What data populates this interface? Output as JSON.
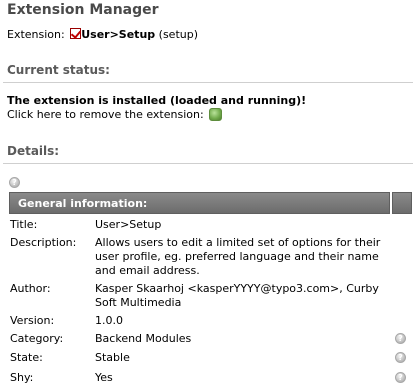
{
  "header": {
    "title": "Extension Manager",
    "extension_label": "Extension:",
    "extension_name": "User>Setup",
    "extension_key": "(setup)"
  },
  "status": {
    "heading": "Current status:",
    "installed_text": "The extension is installed (loaded and running)!",
    "remove_text": "Click here to remove the extension:"
  },
  "details": {
    "heading": "Details:",
    "table_title": "General information:",
    "rows": [
      {
        "label": "Title:",
        "value": "User>Setup"
      },
      {
        "label": "Description:",
        "value": "Allows users to edit a limited set of options for their user profile, eg. preferred language and their name and email address."
      },
      {
        "label": "Author:",
        "value": "Kasper Skaarhoj <kasperYYYY@typo3.com>, Curby Soft Multimedia"
      },
      {
        "label": "Version:",
        "value": "1.0.0"
      },
      {
        "label": "Category:",
        "value": "Backend Modules"
      },
      {
        "label": "State:",
        "value": "Stable"
      },
      {
        "label": "Shy:",
        "value": "Yes"
      }
    ]
  }
}
